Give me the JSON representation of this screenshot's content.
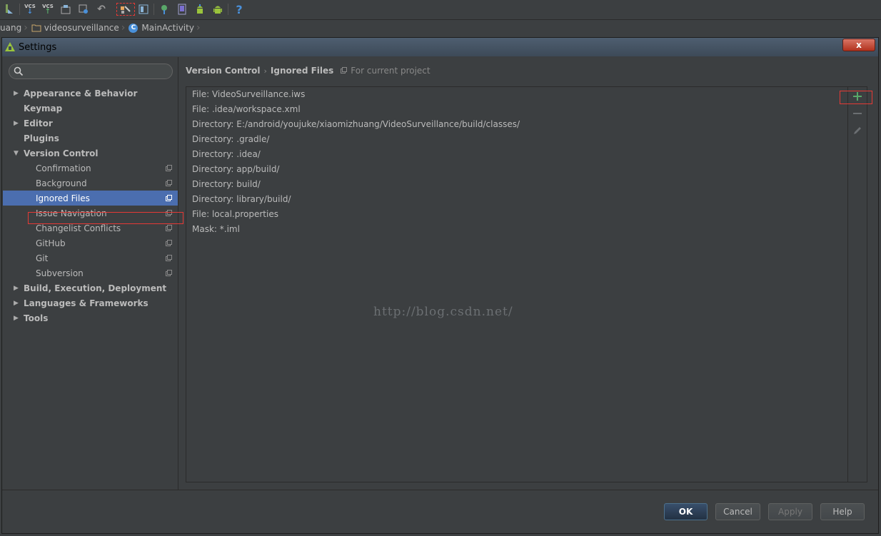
{
  "toolbar": {
    "vcs_update_label": "VCS",
    "vcs_commit_label": "VCS",
    "help_label": "?"
  },
  "breadcrumb": {
    "items": [
      "uang",
      "videosurveillance",
      "MainActivity"
    ],
    "class_badge": "C"
  },
  "dialog": {
    "title": "Settings",
    "close_label": "x"
  },
  "sidebar": {
    "search_placeholder": "",
    "items": [
      {
        "label": "Appearance & Behavior",
        "level": 0,
        "arrow": "collapsed"
      },
      {
        "label": "Keymap",
        "level": 0,
        "arrow": "none"
      },
      {
        "label": "Editor",
        "level": 0,
        "arrow": "collapsed"
      },
      {
        "label": "Plugins",
        "level": 0,
        "arrow": "none"
      },
      {
        "label": "Version Control",
        "level": 0,
        "arrow": "expanded"
      },
      {
        "label": "Confirmation",
        "level": 1
      },
      {
        "label": "Background",
        "level": 1
      },
      {
        "label": "Ignored Files",
        "level": 1,
        "selected": true
      },
      {
        "label": "Issue Navigation",
        "level": 1
      },
      {
        "label": "Changelist Conflicts",
        "level": 1
      },
      {
        "label": "GitHub",
        "level": 1
      },
      {
        "label": "Git",
        "level": 1
      },
      {
        "label": "Subversion",
        "level": 1
      },
      {
        "label": "Build, Execution, Deployment",
        "level": 0,
        "arrow": "collapsed"
      },
      {
        "label": "Languages & Frameworks",
        "level": 0,
        "arrow": "collapsed"
      },
      {
        "label": "Tools",
        "level": 0,
        "arrow": "collapsed"
      }
    ]
  },
  "content": {
    "breadcrumb_parent": "Version Control",
    "breadcrumb_current": "Ignored Files",
    "scope_note": "For current project",
    "ignored_entries": [
      "File: VideoSurveillance.iws",
      "File: .idea/workspace.xml",
      "Directory: E:/android/youjuke/xiaomizhuang/VideoSurveillance/build/classes/",
      "Directory: .gradle/",
      "Directory: .idea/",
      "Directory: app/build/",
      "Directory: build/",
      "Directory: library/build/",
      "File: local.properties",
      "Mask: *.iml"
    ],
    "watermark": "http://blog.csdn.net/"
  },
  "footer": {
    "ok_label": "OK",
    "cancel_label": "Cancel",
    "apply_label": "Apply",
    "help_label": "Help"
  },
  "colors": {
    "background": "#3c3f41",
    "selection": "#4b6eaf",
    "highlight": "#e53935",
    "add_icon": "#59a869"
  }
}
